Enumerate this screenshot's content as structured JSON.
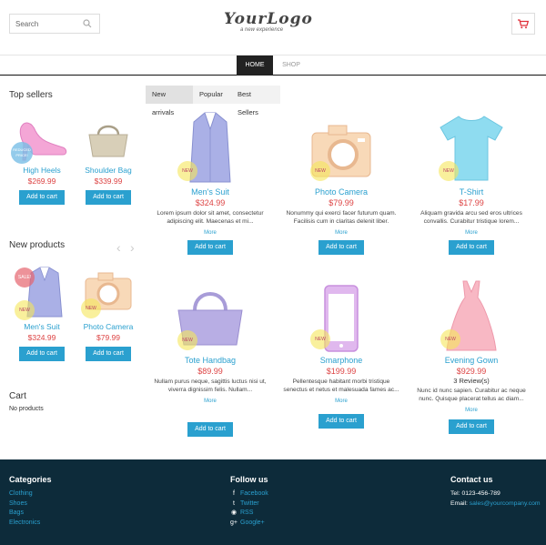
{
  "search": {
    "placeholder": "Search"
  },
  "logo": {
    "text": "YourLogo",
    "tagline": "a new experience"
  },
  "nav": {
    "home": "HOME",
    "shop": "SHOP"
  },
  "sidebar": {
    "top_sellers_title": "Top sellers",
    "top_sellers": [
      {
        "name": "High Heels",
        "price": "$269.99",
        "badge": "REDUCED PRICE!",
        "button": "Add to cart"
      },
      {
        "name": "Shoulder Bag",
        "price": "$339.99",
        "button": "Add to cart"
      }
    ],
    "new_products_title": "New products",
    "new_products": [
      {
        "name": "Men's Suit",
        "price": "$324.99",
        "badge_sale": "SALE!",
        "badge_new": "NEW",
        "button": "Add to cart"
      },
      {
        "name": "Photo Camera",
        "price": "$79.99",
        "badge_new": "NEW",
        "button": "Add to cart"
      }
    ],
    "cart_title": "Cart",
    "cart_empty": "No products"
  },
  "tabs": {
    "new_arrivals": "New arrivals",
    "popular": "Popular",
    "best_sellers": "Best Sellers"
  },
  "products": [
    {
      "name": "Men's Suit",
      "price": "$324.99",
      "badge": "NEW",
      "desc": "Lorem ipsum dolor sit amet, consectetur adipiscing elit. Maecenas et mi...",
      "more": "More",
      "button": "Add to cart"
    },
    {
      "name": "Photo Camera",
      "price": "$79.99",
      "badge": "NEW",
      "desc": "Nonummy qui exerci facer futurum quam. Facilisis cum in claritas delenit liber.",
      "more": "More",
      "button": "Add to cart"
    },
    {
      "name": "T-Shirt",
      "price": "$17.99",
      "badge": "NEW",
      "desc": "Aliquam gravida arcu sed eros ultrices convallis. Curabitur tristique lorem...",
      "more": "More",
      "button": "Add to cart"
    },
    {
      "name": "Tote Handbag",
      "price": "$89.99",
      "badge": "NEW",
      "desc": "Nullam purus neque, sagittis luctus nisi ut, viverra dignissim felis. Nullam...",
      "more": "More",
      "button": "Add to cart"
    },
    {
      "name": "Smarphone",
      "price": "$199.99",
      "badge": "NEW",
      "desc": "Pellentesque habitant morbi tristique senectus et netus et malesuada fames ac...",
      "more": "More",
      "button": "Add to cart"
    },
    {
      "name": "Evening Gown",
      "price": "$929.99",
      "badge": "NEW",
      "reviews": "3 Review(s)",
      "desc": "Nunc id nunc sapien. Curabitur ac neque nunc. Quisque placerat tellus ac diam...",
      "more": "More",
      "button": "Add to cart"
    }
  ],
  "footer": {
    "categories_title": "Categories",
    "categories": [
      "Clothing",
      "Shoes",
      "Bags",
      "Electronics"
    ],
    "follow_title": "Follow us",
    "follow": [
      {
        "icon": "facebook-icon",
        "glyph": "f",
        "label": "Facebook"
      },
      {
        "icon": "twitter-icon",
        "glyph": "t",
        "label": "Twitter"
      },
      {
        "icon": "rss-icon",
        "glyph": "◉",
        "label": "RSS"
      },
      {
        "icon": "google-plus-icon",
        "glyph": "g+",
        "label": "Google+"
      }
    ],
    "contact_title": "Contact us",
    "tel_label": "Tel:",
    "tel": "0123-456-789",
    "email_label": "Email:",
    "email": "sales@yourcompany.com"
  },
  "colors": {
    "accent": "#2aa0cf",
    "price": "#dd4444",
    "footer_bg": "#0d2b3a",
    "nav_active": "#222222"
  }
}
